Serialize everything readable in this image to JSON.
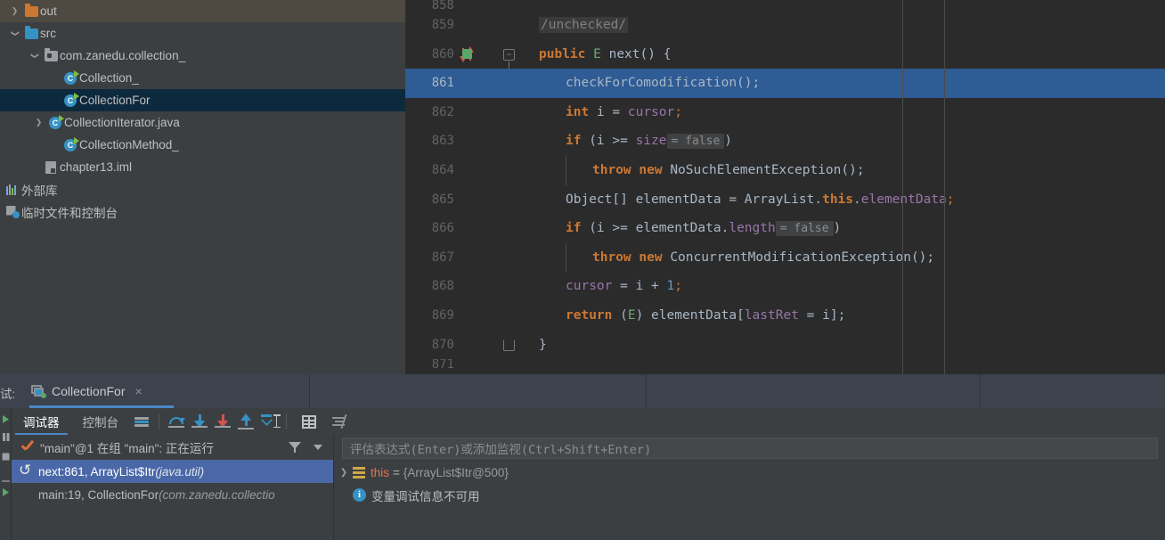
{
  "project_tree": [
    {
      "label": "out",
      "icon": "folder-orange-icon",
      "arrow": "right",
      "indent": 8,
      "state": "collapsed-highlight"
    },
    {
      "label": "src",
      "icon": "folder-blue-icon",
      "arrow": "down",
      "indent": 8,
      "state": "expanded"
    },
    {
      "label": "com.zanedu.collection_",
      "icon": "package-icon",
      "arrow": "down",
      "indent": 30,
      "state": "expanded"
    },
    {
      "label": "Collection_",
      "icon": "java-class-icon",
      "arrow": "none",
      "indent": 52,
      "state": "normal"
    },
    {
      "label": "CollectionFor",
      "icon": "java-class-icon",
      "arrow": "none",
      "indent": 52,
      "state": "selected"
    },
    {
      "label": "CollectionIterator.java",
      "icon": "java-class-icon",
      "arrow": "right",
      "indent": 52,
      "state": "normal"
    },
    {
      "label": "CollectionMethod_",
      "icon": "java-class-icon",
      "arrow": "none",
      "indent": 52,
      "state": "normal"
    },
    {
      "label": "chapter13.iml",
      "icon": "iml-file-icon",
      "arrow": "none",
      "indent": 30,
      "state": "normal"
    },
    {
      "label": "外部库",
      "icon": "external-libraries-icon",
      "arrow": "none",
      "indent": 8,
      "state": "normal"
    },
    {
      "label": "临时文件和控制台",
      "icon": "scratches-consoles-icon",
      "arrow": "none",
      "indent": 8,
      "state": "normal"
    }
  ],
  "editor": {
    "lines": [
      {
        "num": "858",
        "partial_top": true
      },
      {
        "num": "859"
      },
      {
        "num": "860",
        "marker": "method-override-icon",
        "fold": "open"
      },
      {
        "num": "861",
        "highlighted": true
      },
      {
        "num": "862"
      },
      {
        "num": "863"
      },
      {
        "num": "864"
      },
      {
        "num": "865"
      },
      {
        "num": "866"
      },
      {
        "num": "867"
      },
      {
        "num": "868"
      },
      {
        "num": "869"
      },
      {
        "num": "870",
        "fold": "end"
      },
      {
        "num": "871",
        "partial_bottom": true
      }
    ],
    "code": {
      "l859_comment": "/unchecked/",
      "l860_public": "public",
      "l860_type": "E",
      "l860_method": "next() {",
      "l861_call": "checkForComodification();",
      "l862_int": "int",
      "l862_rest": " i = ",
      "l862_cursor": "cursor",
      "l862_semi": ";",
      "l863_if": "if",
      "l863_cond": " (i >= ",
      "l863_size": "size",
      "l863_inline": "= false",
      "l863_close": ")",
      "l864_throw": "throw",
      "l864_new": "new",
      "l864_exc": "NoSuchElementException();",
      "l865_obj": "Object[] elementData = ArrayList.",
      "l865_this": "this",
      "l865_dot": ".",
      "l865_fld": "elementData",
      "l865_semi": ";",
      "l866_if": "if",
      "l866_cond": " (i >= elementData.",
      "l866_length": "length",
      "l866_inline": "= false",
      "l866_close": ")",
      "l867_throw": "throw",
      "l867_new": "new",
      "l867_exc": "ConcurrentModificationException();",
      "l868_cursor": "cursor",
      "l868_mid": " = i + ",
      "l868_num": "1",
      "l868_semi": ";",
      "l869_return": "return",
      "l869_paren1": " (",
      "l869_E": "E",
      "l869_paren2": ") elementData[",
      "l869_lastRet": "lastRet",
      "l869_tail": " = i];",
      "l870_brace": "}"
    }
  },
  "tabstrip": {
    "debug_prefix": "试:",
    "tab_title": "CollectionFor",
    "close_glyph": "×"
  },
  "debug_toolbar": {
    "tab_debugger": "调试器",
    "tab_console": "控制台",
    "icons": [
      "frames-view-icon",
      "step-over-icon",
      "step-into-icon",
      "force-step-into-icon",
      "step-out-icon",
      "run-to-cursor-icon",
      "evaluate-expression-icon",
      "settings-icon"
    ]
  },
  "frames": {
    "thread_label": "\"main\"@1 在组 \"main\": 正在运行",
    "rows": [
      {
        "text": "next:861, ArrayList$Itr ",
        "pkg": "(java.util)",
        "selected": true
      },
      {
        "text": "main:19, CollectionFor ",
        "pkg": "(com.zanedu.collectio",
        "selected": false
      }
    ]
  },
  "variables": {
    "watch_placeholder": "评估表达式(Enter)或添加监视(Ctrl+Shift+Enter)",
    "rows": [
      {
        "kind": "field",
        "name": "this",
        "eq": "=",
        "value": "{ArrayList$Itr@500}"
      },
      {
        "kind": "info",
        "message": "变量调试信息不可用"
      }
    ]
  },
  "colors": {
    "panel_bg": "#3c3f41",
    "editor_bg": "#2b2b2b",
    "highlight_line": "#2f5c94",
    "tree_selected": "#0d293e",
    "tree_out_highlight": "#4e4a41",
    "frame_selected": "#4a68a8",
    "tab_strip_bg": "#3c434c",
    "accent_blue": "#4a88c7",
    "keyword_orange": "#cc7832",
    "field_purple": "#9876aa",
    "number_blue": "#6897bb",
    "generic_green": "#6aab73"
  }
}
